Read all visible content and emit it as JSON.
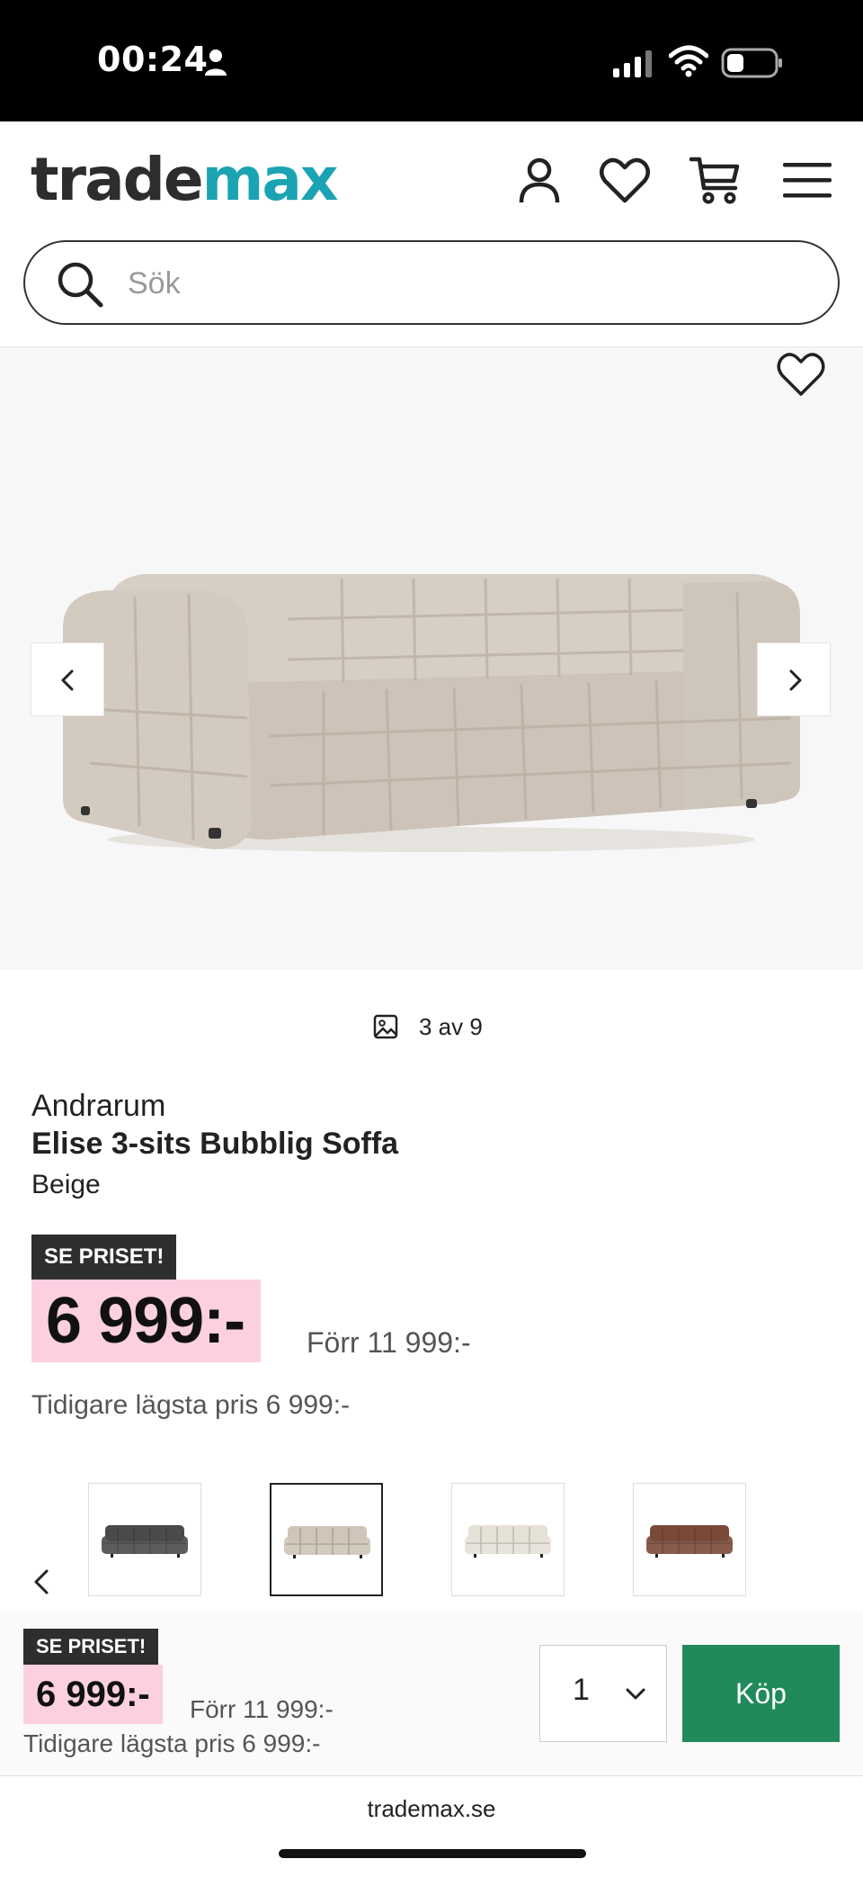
{
  "status_bar": {
    "time": "00:24"
  },
  "header": {
    "logo_part1": "trade",
    "logo_part2": "max",
    "logo_colors": {
      "trade": "#2d2d2d",
      "max": "#1aa3b3"
    },
    "icons": [
      "account-icon",
      "heart-icon",
      "cart-icon",
      "hamburger-menu-icon"
    ]
  },
  "search": {
    "placeholder": "Sök",
    "value": ""
  },
  "gallery": {
    "counter": "3 av 9"
  },
  "product": {
    "brand": "Andrarum",
    "name": "Elise 3-sits Bubblig Soffa",
    "variant": "Beige",
    "badge": "SE PRISET!",
    "price": "6 999:-",
    "price_before": "Förr 11 999:-",
    "lowest_price": "Tidigare lägsta pris 6 999:-",
    "price_highlight_color": "#fcd0e0",
    "color_variants": [
      {
        "name": "dark-grey",
        "color": "#4a4a4a",
        "selected": false
      },
      {
        "name": "beige",
        "color": "#cfc5b8",
        "selected": true
      },
      {
        "name": "cream",
        "color": "#e6e1d7",
        "selected": false
      },
      {
        "name": "brown",
        "color": "#7a4a38",
        "selected": false
      }
    ]
  },
  "buy_bar": {
    "badge": "SE PRISET!",
    "price": "6 999:-",
    "price_before": "Förr 11 999:-",
    "lowest_price": "Tidigare lägsta pris 6 999:-",
    "quantity": "1",
    "buy_label": "Köp",
    "buy_color": "#218a5a"
  },
  "browser": {
    "url": "trademax.se"
  }
}
